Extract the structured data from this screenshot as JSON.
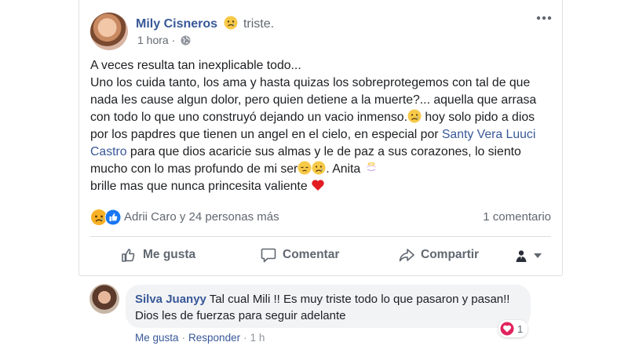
{
  "post": {
    "author": "Mily Cisneros",
    "feeling": "triste.",
    "time": "1 hora",
    "body_1": "A veces resulta tan inexplicable todo...",
    "body_2": "Uno los cuida tanto, los ama y hasta quizas los sobreprotegemos con tal de que nada les cause algun dolor, pero quien detiene a la muerte?... aquella que arrasa con todo lo que uno construyó dejando un vacio inmenso.",
    "body_3": " hoy solo pido a dios por los papdres que tienen un angel en el cielo, en especial por ",
    "mention": "Santy Vera Luuci Castro",
    "body_4": " para que dios acaricie sus almas y le de paz a sus corazones, lo siento mucho con lo mas profundo de mi ser",
    "body_5": ". Anita ",
    "body_6": "brille mas que nunca princesita valiente ",
    "reactions_text": "Adrii Caro y 24 personas más",
    "comments_count": "1 comentario"
  },
  "actions": {
    "like": "Me gusta",
    "comment": "Comentar",
    "share": "Compartir"
  },
  "comment": {
    "author": "Silva Juanyy",
    "text": " Tal cual Mili !! Es muy triste todo lo que pasaron y pasan!! Dios les de fuerzas para seguir adelante",
    "reaction_count": "1",
    "like": "Me gusta",
    "reply": "Responder",
    "time": "1 h",
    "sep": "·"
  },
  "icons": {
    "feeling": "sad-face-icon",
    "audience": "globe-icon",
    "options": "more-options-icon",
    "reaction_sad": "sad-reaction-icon",
    "reaction_like": "like-reaction-icon",
    "like_btn": "thumbs-up-icon",
    "comment_btn": "comment-bubble-icon",
    "share_btn": "share-arrow-icon",
    "comment_reaction": "love-reaction-icon"
  },
  "colors": {
    "link": "#385898",
    "secondary_text": "#616770",
    "like_blue": "#1877f2",
    "love_red": "#e0245e",
    "sad_yellow": "#f7b125"
  }
}
